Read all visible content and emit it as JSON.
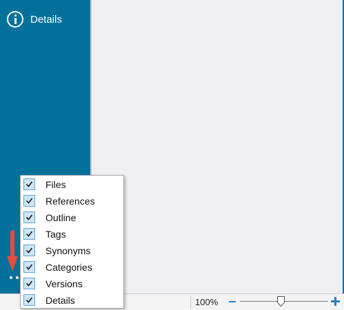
{
  "sidebar": {
    "details_label": "Details",
    "background": "#03719c"
  },
  "menu": {
    "items": [
      {
        "label": "Files",
        "checked": true
      },
      {
        "label": "References",
        "checked": true
      },
      {
        "label": "Outline",
        "checked": true
      },
      {
        "label": "Tags",
        "checked": true
      },
      {
        "label": "Synonyms",
        "checked": true
      },
      {
        "label": "Categories",
        "checked": true
      },
      {
        "label": "Versions",
        "checked": true
      },
      {
        "label": "Details",
        "checked": true
      }
    ]
  },
  "statusbar": {
    "zoom_label": "100%",
    "zoom_level_percent": 100
  },
  "annotation": {
    "arrow_color": "#e64b3c"
  }
}
